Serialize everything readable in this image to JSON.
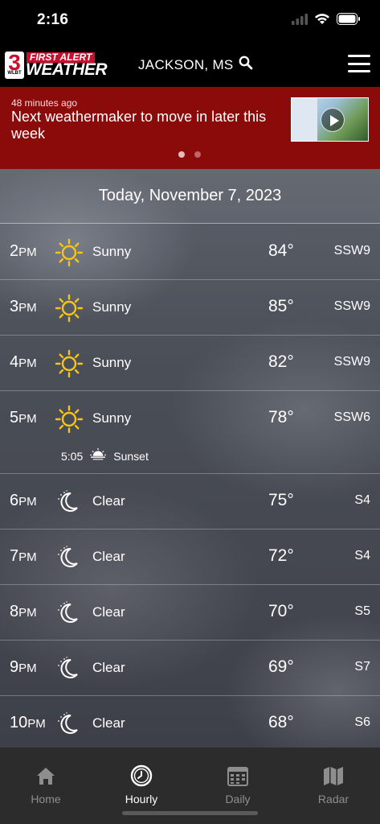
{
  "status_bar": {
    "time": "2:16"
  },
  "header": {
    "logo": {
      "number": "3",
      "station": "WLBT",
      "first_alert": "FIRST ALERT",
      "weather": "WEATHER"
    },
    "location": "JACKSON, MS",
    "icons": {
      "search": "search-icon",
      "menu": "hamburger-menu-icon"
    }
  },
  "banner": {
    "timestamp": "48 minutes ago",
    "headline": "Next weathermaker to move in later this week",
    "page_count": 2,
    "active_page": 1,
    "colors": {
      "background": "#8b0a0a"
    }
  },
  "forecast": {
    "date": "Today, November 7, 2023",
    "hours": [
      {
        "hour": "2",
        "ampm": "PM",
        "icon": "sun-icon",
        "condition": "Sunny",
        "temp": "84°",
        "wind": "SSW9"
      },
      {
        "hour": "3",
        "ampm": "PM",
        "icon": "sun-icon",
        "condition": "Sunny",
        "temp": "85°",
        "wind": "SSW9"
      },
      {
        "hour": "4",
        "ampm": "PM",
        "icon": "sun-icon",
        "condition": "Sunny",
        "temp": "82°",
        "wind": "SSW9"
      },
      {
        "hour": "5",
        "ampm": "PM",
        "icon": "sun-icon",
        "condition": "Sunny",
        "temp": "78°",
        "wind": "SSW6",
        "event": {
          "time": "5:05",
          "label": "Sunset",
          "icon": "sunset-icon"
        }
      },
      {
        "hour": "6",
        "ampm": "PM",
        "icon": "moon-icon",
        "condition": "Clear",
        "temp": "75°",
        "wind": "S4"
      },
      {
        "hour": "7",
        "ampm": "PM",
        "icon": "moon-icon",
        "condition": "Clear",
        "temp": "72°",
        "wind": "S4"
      },
      {
        "hour": "8",
        "ampm": "PM",
        "icon": "moon-icon",
        "condition": "Clear",
        "temp": "70°",
        "wind": "S5"
      },
      {
        "hour": "9",
        "ampm": "PM",
        "icon": "moon-icon",
        "condition": "Clear",
        "temp": "69°",
        "wind": "S7"
      },
      {
        "hour": "10",
        "ampm": "PM",
        "icon": "moon-icon",
        "condition": "Clear",
        "temp": "68°",
        "wind": "S6"
      }
    ]
  },
  "tab_bar": {
    "tabs": [
      {
        "label": "Home",
        "icon": "home-icon",
        "active": false
      },
      {
        "label": "Hourly",
        "icon": "clock-icon",
        "active": true
      },
      {
        "label": "Daily",
        "icon": "calendar-icon",
        "active": false
      },
      {
        "label": "Radar",
        "icon": "map-icon",
        "active": false
      }
    ]
  },
  "colors": {
    "sun": "#f5c518",
    "accent_red": "#c8102e",
    "tab_inactive": "#8e8e8e"
  }
}
